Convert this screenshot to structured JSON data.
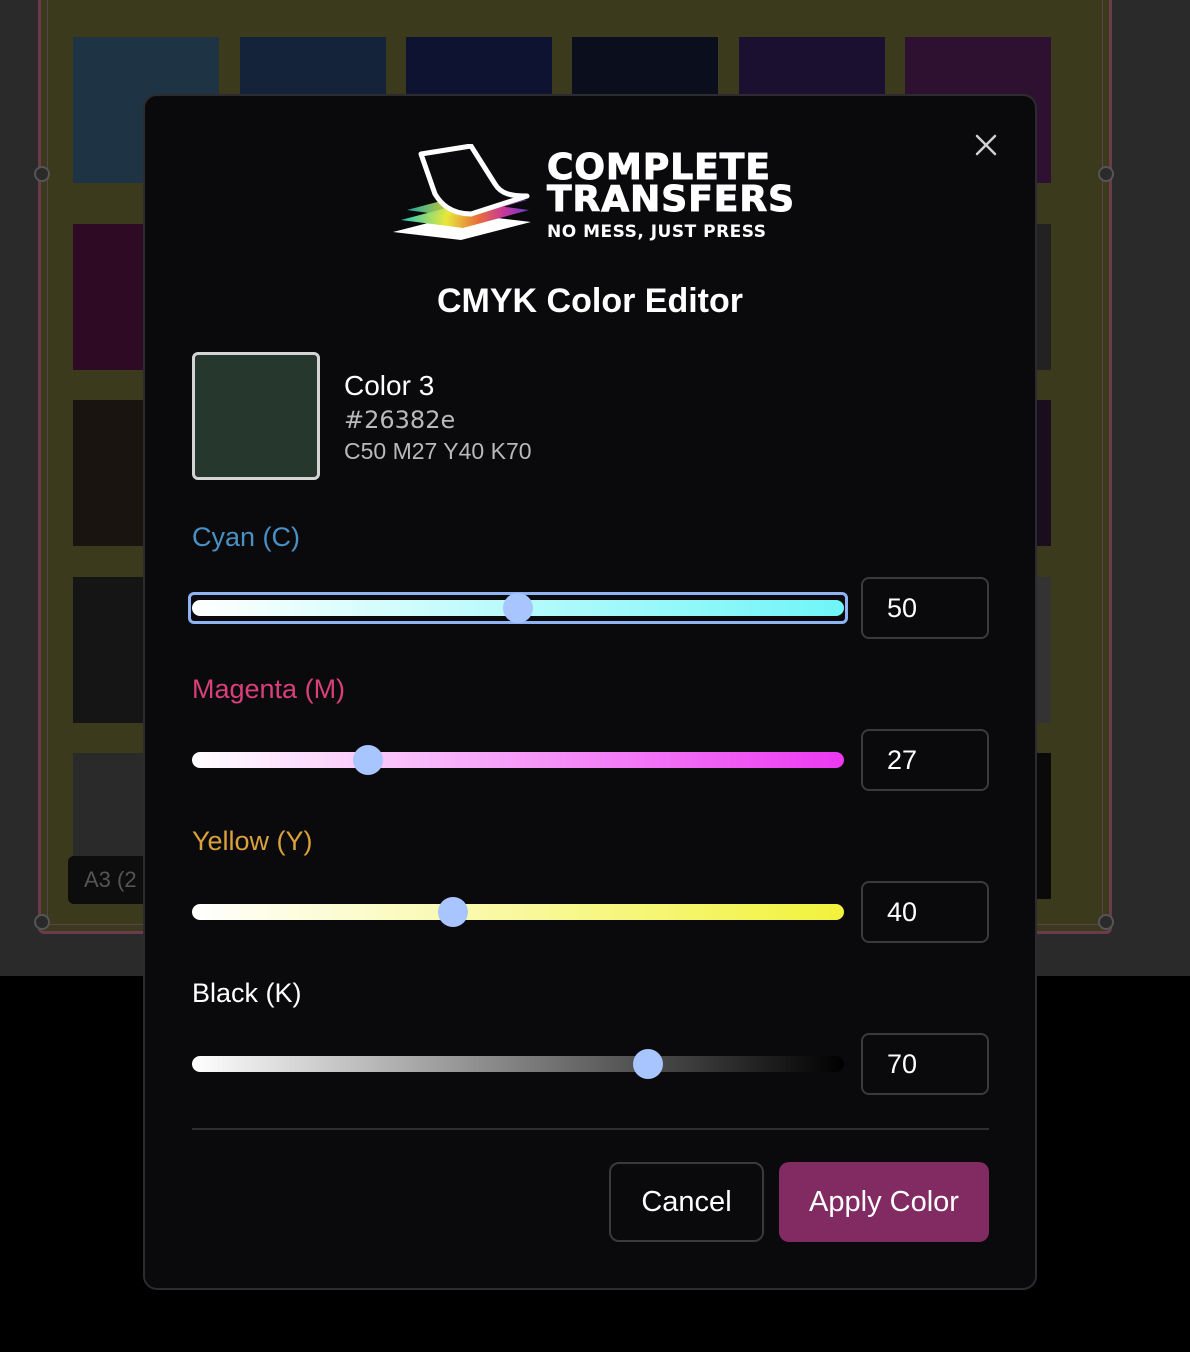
{
  "background": {
    "sheet_label": "A3 (2"
  },
  "modal": {
    "logo": {
      "line1": "COMPLETE",
      "line2": "TRANSFERS",
      "tagline": "NO MESS, JUST PRESS"
    },
    "title": "CMYK Color Editor",
    "close_icon": "close-icon",
    "color": {
      "name": "Color 3",
      "hex": "#26382e",
      "cmyk_text": "C50 M27 Y40 K70"
    },
    "channels": [
      {
        "key": "cyan",
        "label": "Cyan (C)",
        "value": "50",
        "label_color": "#4a90c4",
        "gradient_from": "#ffffff",
        "gradient_to": "#6ff5f8"
      },
      {
        "key": "magenta",
        "label": "Magenta (M)",
        "value": "27",
        "label_color": "#d9407a",
        "gradient_from": "#ffffff",
        "gradient_to": "#ec38f2"
      },
      {
        "key": "yellow",
        "label": "Yellow (Y)",
        "value": "40",
        "label_color": "#d9a03c",
        "gradient_from": "#ffffff",
        "gradient_to": "#f2f23a"
      },
      {
        "key": "black",
        "label": "Black (K)",
        "value": "70",
        "label_color": "#ffffff",
        "gradient_from": "#ffffff",
        "gradient_to": "#000000"
      }
    ],
    "buttons": {
      "cancel": "Cancel",
      "apply": "Apply Color",
      "apply_color": "#822a62"
    }
  }
}
